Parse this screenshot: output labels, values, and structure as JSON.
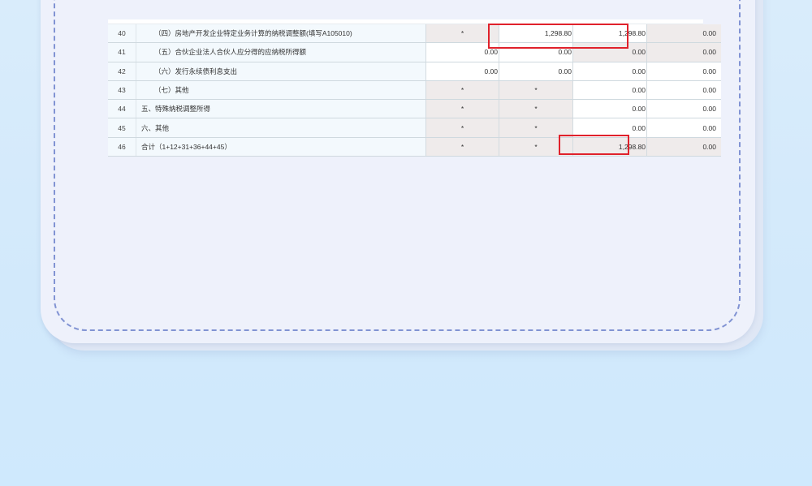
{
  "table": {
    "rows": [
      {
        "no": "40",
        "name": "（四）房地产开发企业特定业务计算的纳税调整额(填写A105010)",
        "indent": true,
        "cells": [
          {
            "value": "*",
            "type": "ro"
          },
          {
            "value": "1,298.80",
            "type": "ed"
          },
          {
            "value": "1,298.80",
            "type": "ed"
          },
          {
            "value": "0.00",
            "type": "ro"
          }
        ]
      },
      {
        "no": "41",
        "name": "（五）合伙企业法人合伙人应分得的应纳税所得额",
        "indent": true,
        "cells": [
          {
            "value": "0.00",
            "type": "ed"
          },
          {
            "value": "0.00",
            "type": "ed"
          },
          {
            "value": "0.00",
            "type": "ro"
          },
          {
            "value": "0.00",
            "type": "ro"
          }
        ]
      },
      {
        "no": "42",
        "name": "（六）发行永续债利息支出",
        "indent": true,
        "cells": [
          {
            "value": "0.00",
            "type": "ed"
          },
          {
            "value": "0.00",
            "type": "ed"
          },
          {
            "value": "0.00",
            "type": "ed"
          },
          {
            "value": "0.00",
            "type": "ed"
          }
        ]
      },
      {
        "no": "43",
        "name": "（七）其他",
        "indent": true,
        "cells": [
          {
            "value": "*",
            "type": "ro"
          },
          {
            "value": "*",
            "type": "ro"
          },
          {
            "value": "0.00",
            "type": "ed"
          },
          {
            "value": "0.00",
            "type": "ed"
          }
        ]
      },
      {
        "no": "44",
        "name": "五、特殊纳税调整所得",
        "indent": false,
        "cells": [
          {
            "value": "*",
            "type": "ro"
          },
          {
            "value": "*",
            "type": "ro"
          },
          {
            "value": "0.00",
            "type": "ed"
          },
          {
            "value": "0.00",
            "type": "ed"
          }
        ]
      },
      {
        "no": "45",
        "name": "六、其他",
        "indent": false,
        "cells": [
          {
            "value": "*",
            "type": "ro"
          },
          {
            "value": "*",
            "type": "ro"
          },
          {
            "value": "0.00",
            "type": "ed"
          },
          {
            "value": "0.00",
            "type": "ed"
          }
        ]
      },
      {
        "no": "46",
        "name": "合计（1+12+31+36+44+45）",
        "indent": false,
        "cells": [
          {
            "value": "*",
            "type": "ro"
          },
          {
            "value": "*",
            "type": "ro"
          },
          {
            "value": "1,298.80",
            "type": "ro"
          },
          {
            "value": "0.00",
            "type": "ro"
          }
        ]
      }
    ]
  },
  "colors": {
    "highlight": "#e0212b",
    "readonly_cell": "#efebeb",
    "label_cell": "#f3f9fd",
    "dashed_border": "#8193d3"
  }
}
